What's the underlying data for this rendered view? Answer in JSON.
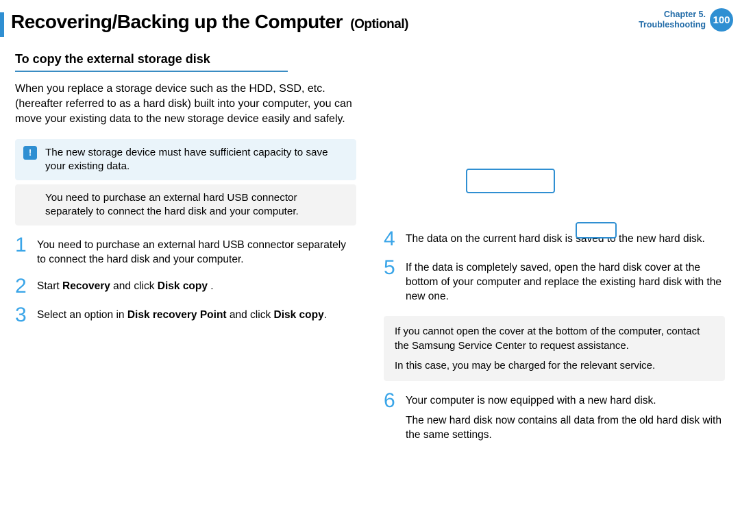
{
  "header": {
    "title_main": "Recovering/Backing up the Computer",
    "title_suffix": "(Optional)",
    "chapter_line1": "Chapter 5.",
    "chapter_line2": "Troubleshooting",
    "page_number": "100"
  },
  "left": {
    "subhead": "To copy the external storage disk",
    "intro": "When you replace a storage device such as the HDD, SSD, etc. (hereafter referred to as a hard disk) built into your computer, you can move your existing data to the new storage device easily and safely.",
    "note_important": "The new storage device must have sufficient capacity to save your existing data.",
    "note_sub": "You need to purchase an external hard USB connector separately to connect the hard disk and your computer.",
    "step1": "You need to purchase an external hard USB connector separately to connect the hard disk and your computer.",
    "step2_a": "Start ",
    "step2_b": "Recovery",
    "step2_c": " and click ",
    "step2_d": "Disk copy",
    "step2_e": "        .",
    "step3_a": "Select an option in ",
    "step3_b": "Disk recovery Point",
    "step3_c": " and click ",
    "step3_d": "Disk copy",
    "step3_e": "."
  },
  "right": {
    "step4": "The data on the current hard disk is saved to the new hard disk.",
    "step5": "If the data is completely saved, open the hard disk cover at the bottom of your computer and replace the existing hard disk with the new one.",
    "note_p1": "If you cannot open the cover at the bottom of the computer, contact the Samsung Service Center to request assistance.",
    "note_p2": "In this case, you may be charged for the relevant service.",
    "step6_p1": "Your computer is now equipped with a new hard disk.",
    "step6_p2": "The new hard disk now contains all data from the old hard disk with the same settings."
  },
  "nums": {
    "n1": "1",
    "n2": "2",
    "n3": "3",
    "n4": "4",
    "n5": "5",
    "n6": "6"
  }
}
